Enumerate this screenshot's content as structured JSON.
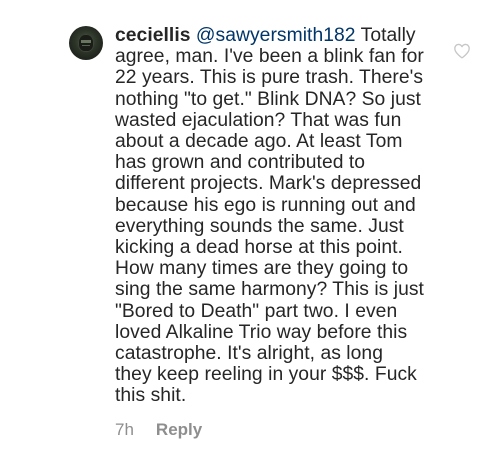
{
  "comment": {
    "username": "ceciellis",
    "mention": "@sawyersmith182",
    "text": "Totally\nagree, man. I've been a blink fan for\n22 years. This is pure trash. There's\nnothing \"to get.\" Blink DNA? So just\nwasted ejaculation? That was fun\nabout a decade ago. At least Tom\nhas grown and contributed to\ndifferent projects. Mark's depressed\nbecause his ego is running out and\neverything sounds the same. Just\nkicking a dead horse at this point.\nHow many times are they going to\nsing the same harmony? This is just\n\"Bored to Death\" part two.  I even\nloved Alkaline Trio way before this\ncatastrophe. It's alright, as long\nthey keep reeling in your $$$. Fuck\nthis shit.",
    "time": "7h",
    "reply_label": "Reply",
    "like_icon": "heart-outline-icon"
  },
  "colors": {
    "text": "#262626",
    "mention": "#003569",
    "meta": "#8e8e8e",
    "icon": "#c7c7c7"
  }
}
